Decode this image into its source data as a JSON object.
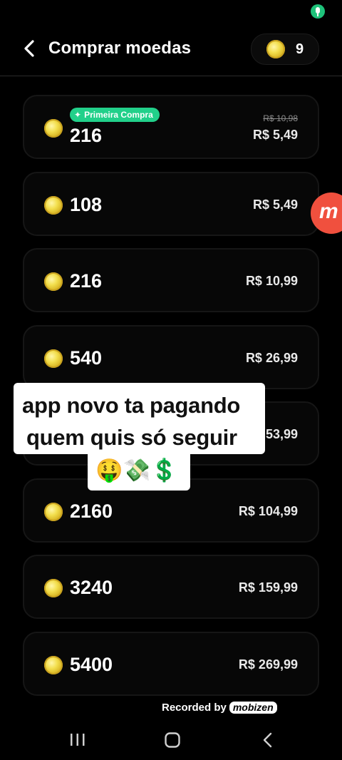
{
  "status_bar": {
    "mic_icon": "mic-icon"
  },
  "header": {
    "back_icon": "chevron-left-icon",
    "title": "Comprar moedas",
    "balance": "9"
  },
  "packages": [
    {
      "amount": "216",
      "price": "R$ 5,49",
      "old_price": "R$ 10,98",
      "badge": "Primeira Compra"
    },
    {
      "amount": "108",
      "price": "R$ 5,49"
    },
    {
      "amount": "216",
      "price": "R$ 10,99"
    },
    {
      "amount": "540",
      "price": "R$ 26,99"
    },
    {
      "amount": "",
      "price": "53,99"
    },
    {
      "amount": "2160",
      "price": "R$ 104,99"
    },
    {
      "amount": "3240",
      "price": "R$ 159,99"
    },
    {
      "amount": "5400",
      "price": "R$ 269,99"
    }
  ],
  "overlay": {
    "caption_line1": "app novo ta pagando",
    "caption_line2": "quem quis só seguir",
    "caption_emoji": "🤑💸💲",
    "recorder_button_letter": "m",
    "watermark_text": "Recorded by",
    "watermark_logo": "mobizen"
  },
  "nav": {
    "recents_icon": "recents-icon",
    "home_icon": "home-icon",
    "back_icon": "back-icon"
  },
  "colors": {
    "background": "#000000",
    "badge": "#22d08a",
    "coin": "#f3df4e",
    "recorder_button": "#f0503e"
  }
}
